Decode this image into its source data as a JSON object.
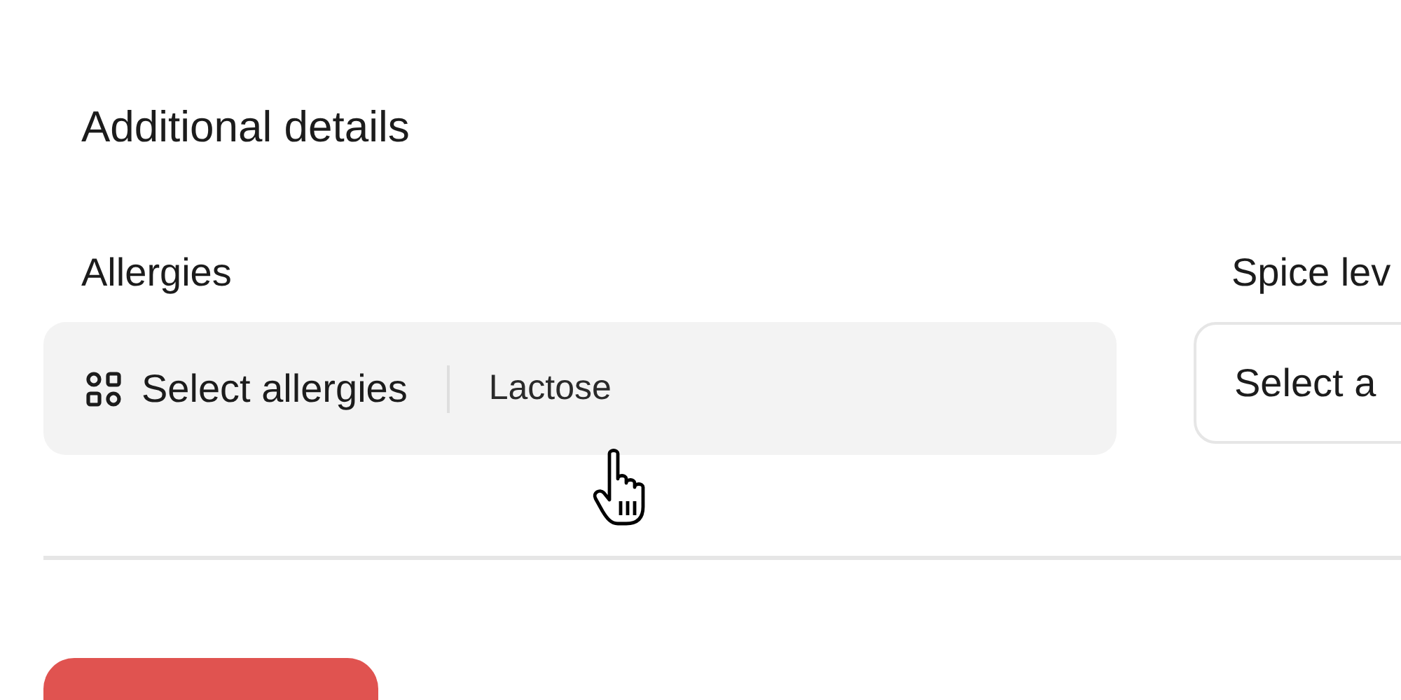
{
  "section": {
    "title": "Additional details"
  },
  "fields": [
    {
      "kind": "multiselect",
      "label": "Allergies",
      "placeholder": "Select allergies",
      "values": [
        "Lactose"
      ]
    },
    {
      "kind": "select",
      "label": "Spice lev",
      "placeholder": "Select a"
    }
  ],
  "actions": [
    {
      "kind": "primary"
    }
  ]
}
